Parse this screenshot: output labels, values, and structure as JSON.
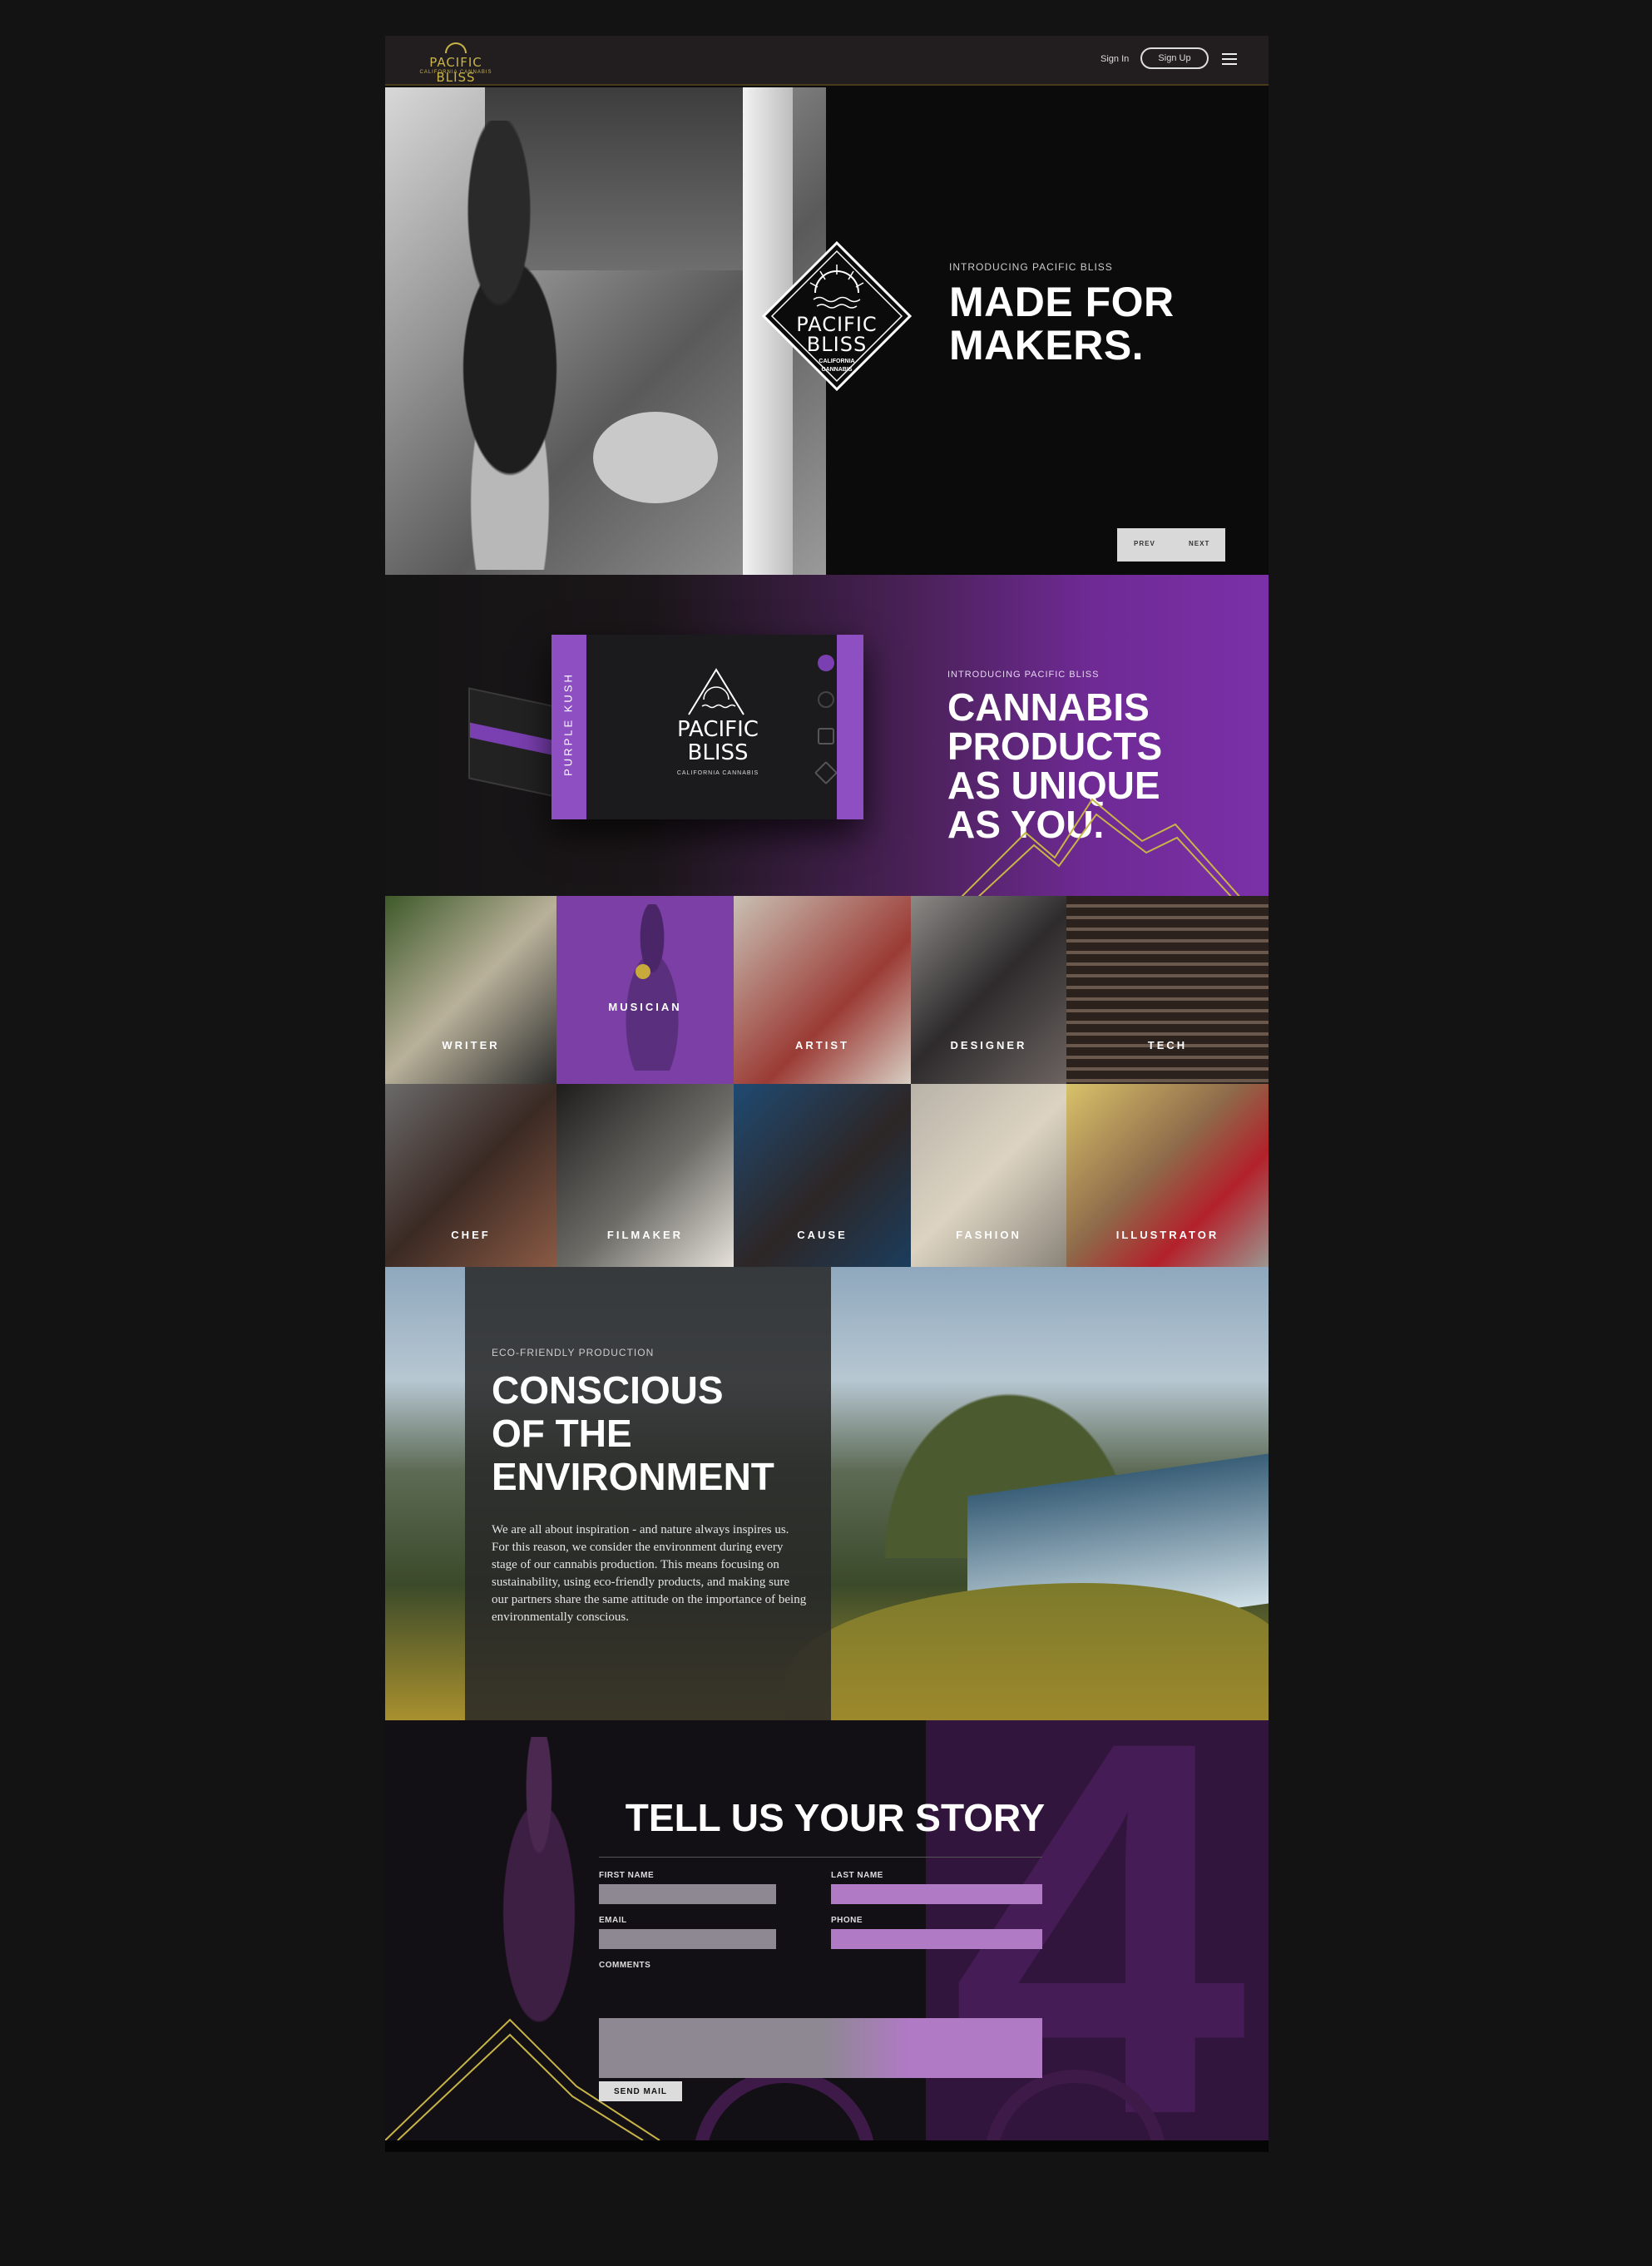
{
  "nav": {
    "logo_text": "PACIFIC BLISS",
    "logo_sub": "CALIFORNIA CANNABIS",
    "sign_in": "Sign In",
    "sign_up": "Sign Up",
    "menu_icon": "hamburger-menu-icon"
  },
  "hero": {
    "eyebrow": "INTRODUCING PACIFIC BLISS",
    "title": "MADE FOR\nMAKERS.",
    "badge_brand": "PACIFIC BLISS",
    "badge_sub": "CALIFORNIA CANNABIS",
    "prev": "PREV",
    "next": "NEXT"
  },
  "product": {
    "eyebrow": "INTRODUCING PACIFIC BLISS",
    "title": "CANNABIS\nPRODUCTS\nAS UNIQUE\nAS YOU.",
    "box_label": "PURPLE KUSH",
    "box_brand": "PACIFIC\nBLISS",
    "box_sub": "CALIFORNIA CANNABIS",
    "accent": "#7b30a8"
  },
  "makers": [
    {
      "label": "WRITER"
    },
    {
      "label": "MUSICIAN"
    },
    {
      "label": "ARTIST"
    },
    {
      "label": "DESIGNER"
    },
    {
      "label": "TECH"
    },
    {
      "label": "CHEF"
    },
    {
      "label": "FILMAKER"
    },
    {
      "label": "CAUSE"
    },
    {
      "label": "FASHION"
    },
    {
      "label": "ILLUSTRATOR"
    }
  ],
  "eco": {
    "eyebrow": "ECO-FRIENDLY PRODUCTION",
    "title": "CONSCIOUS\nOF THE\nENVIRONMENT",
    "body": "We are all about inspiration - and nature always inspires us. For this reason, we consider the environment during every stage of our cannabis production. This means focusing on sustainability, using eco-friendly products, and making sure our partners share the same attitude on the importance of being environmentally conscious."
  },
  "story": {
    "title": "TELL US YOUR STORY",
    "first_name": "FIRST NAME",
    "last_name": "LAST NAME",
    "email": "EMAIL",
    "phone": "PHONE",
    "comments": "COMMENTS",
    "send": "SEND MAIL"
  }
}
